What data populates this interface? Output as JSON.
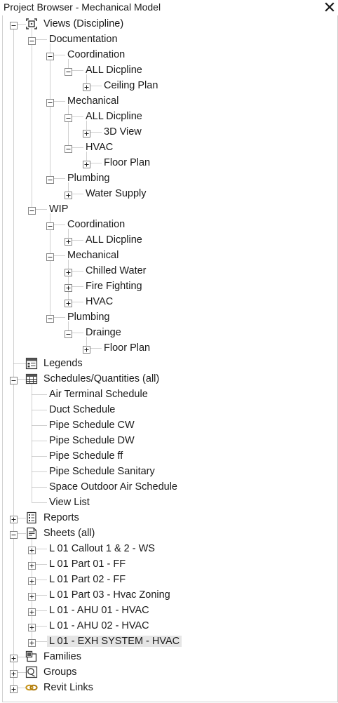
{
  "window": {
    "title": "Project Browser - Mechanical Model",
    "close_icon": "close-icon"
  },
  "tree": [
    {
      "id": "views",
      "label": "Views (Discipline)",
      "depth": 0,
      "toggle": "minus",
      "icon": "views-icon"
    },
    {
      "id": "documentation",
      "label": "Documentation",
      "depth": 1,
      "toggle": "minus"
    },
    {
      "id": "doc-coordination",
      "label": "Coordination",
      "depth": 2,
      "toggle": "minus"
    },
    {
      "id": "doc-coord-all",
      "label": "ALL Dicpline",
      "depth": 3,
      "toggle": "minus"
    },
    {
      "id": "doc-coord-all-ceiling",
      "label": "Ceiling Plan",
      "depth": 4,
      "toggle": "plus"
    },
    {
      "id": "doc-mechanical",
      "label": "Mechanical",
      "depth": 2,
      "toggle": "minus"
    },
    {
      "id": "doc-mech-all",
      "label": "ALL Dicpline",
      "depth": 3,
      "toggle": "minus"
    },
    {
      "id": "doc-mech-all-3d",
      "label": "3D View",
      "depth": 4,
      "toggle": "plus"
    },
    {
      "id": "doc-mech-hvac",
      "label": "HVAC",
      "depth": 3,
      "toggle": "minus"
    },
    {
      "id": "doc-mech-hvac-floor",
      "label": "Floor Plan",
      "depth": 4,
      "toggle": "plus"
    },
    {
      "id": "doc-plumbing",
      "label": "Plumbing",
      "depth": 2,
      "toggle": "minus"
    },
    {
      "id": "doc-plumb-water",
      "label": "Water Supply",
      "depth": 3,
      "toggle": "plus"
    },
    {
      "id": "wip",
      "label": "WIP",
      "depth": 1,
      "toggle": "minus"
    },
    {
      "id": "wip-coordination",
      "label": "Coordination",
      "depth": 2,
      "toggle": "minus"
    },
    {
      "id": "wip-coord-all",
      "label": "ALL Dicpline",
      "depth": 3,
      "toggle": "plus"
    },
    {
      "id": "wip-mechanical",
      "label": "Mechanical",
      "depth": 2,
      "toggle": "minus"
    },
    {
      "id": "wip-mech-chilled",
      "label": "Chilled Water",
      "depth": 3,
      "toggle": "plus"
    },
    {
      "id": "wip-mech-fire",
      "label": "Fire Fighting",
      "depth": 3,
      "toggle": "plus"
    },
    {
      "id": "wip-mech-hvac",
      "label": "HVAC",
      "depth": 3,
      "toggle": "plus"
    },
    {
      "id": "wip-plumbing",
      "label": "Plumbing",
      "depth": 2,
      "toggle": "minus"
    },
    {
      "id": "wip-plumb-drainge",
      "label": "Drainge",
      "depth": 3,
      "toggle": "minus"
    },
    {
      "id": "wip-plumb-drainge-floor",
      "label": "Floor Plan",
      "depth": 4,
      "toggle": "plus"
    },
    {
      "id": "legends",
      "label": "Legends",
      "depth": 0,
      "toggle": "none",
      "icon": "legends-icon"
    },
    {
      "id": "schedules",
      "label": "Schedules/Quantities (all)",
      "depth": 0,
      "toggle": "minus",
      "icon": "schedule-icon"
    },
    {
      "id": "sched-air",
      "label": "Air Terminal Schedule",
      "depth": 1,
      "toggle": "none"
    },
    {
      "id": "sched-duct",
      "label": "Duct Schedule",
      "depth": 1,
      "toggle": "none"
    },
    {
      "id": "sched-pipe-cw",
      "label": "Pipe Schedule CW",
      "depth": 1,
      "toggle": "none"
    },
    {
      "id": "sched-pipe-dw",
      "label": "Pipe Schedule DW",
      "depth": 1,
      "toggle": "none"
    },
    {
      "id": "sched-pipe-ff",
      "label": "Pipe Schedule ff",
      "depth": 1,
      "toggle": "none"
    },
    {
      "id": "sched-pipe-san",
      "label": "Pipe Schedule Sanitary",
      "depth": 1,
      "toggle": "none"
    },
    {
      "id": "sched-space",
      "label": "Space Outdoor Air Schedule",
      "depth": 1,
      "toggle": "none"
    },
    {
      "id": "sched-viewlist",
      "label": "View List",
      "depth": 1,
      "toggle": "none"
    },
    {
      "id": "reports",
      "label": "Reports",
      "depth": 0,
      "toggle": "plus",
      "icon": "reports-icon"
    },
    {
      "id": "sheets",
      "label": "Sheets (all)",
      "depth": 0,
      "toggle": "minus",
      "icon": "sheets-icon"
    },
    {
      "id": "sheet-1",
      "label": "L 01  Callout 1 & 2 - WS",
      "depth": 1,
      "toggle": "plus"
    },
    {
      "id": "sheet-2",
      "label": "L 01  Part 01 - FF",
      "depth": 1,
      "toggle": "plus"
    },
    {
      "id": "sheet-3",
      "label": "L 01  Part 02 - FF",
      "depth": 1,
      "toggle": "plus"
    },
    {
      "id": "sheet-4",
      "label": "L 01  Part 03 - Hvac Zoning",
      "depth": 1,
      "toggle": "plus"
    },
    {
      "id": "sheet-5",
      "label": "L 01 - AHU 01 - HVAC",
      "depth": 1,
      "toggle": "plus"
    },
    {
      "id": "sheet-6",
      "label": "L 01 - AHU 02 - HVAC",
      "depth": 1,
      "toggle": "plus"
    },
    {
      "id": "sheet-7",
      "label": "L 01 - EXH SYSTEM - HVAC",
      "depth": 1,
      "toggle": "plus",
      "selected": true
    },
    {
      "id": "families",
      "label": "Families",
      "depth": 0,
      "toggle": "plus",
      "icon": "families-icon"
    },
    {
      "id": "groups",
      "label": "Groups",
      "depth": 0,
      "toggle": "plus",
      "icon": "groups-icon"
    },
    {
      "id": "revit-links",
      "label": "Revit Links",
      "depth": 0,
      "toggle": "plus",
      "icon": "revit-links-icon"
    }
  ]
}
